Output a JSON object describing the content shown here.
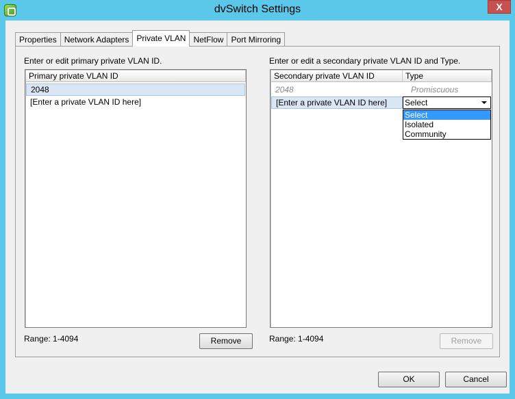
{
  "window": {
    "title": "dvSwitch Settings",
    "close_label": "X"
  },
  "tabs": [
    {
      "label": "Properties"
    },
    {
      "label": "Network Adapters"
    },
    {
      "label": "Private VLAN"
    },
    {
      "label": "NetFlow"
    },
    {
      "label": "Port Mirroring"
    }
  ],
  "primary": {
    "instruction": "Enter or edit primary private VLAN ID.",
    "column": "Primary private VLAN ID",
    "rows": [
      "2048",
      "[Enter a private VLAN ID here]"
    ],
    "range": "Range: 1-4094",
    "remove_label": "Remove"
  },
  "secondary": {
    "instruction": "Enter or edit a secondary private VLAN ID and Type.",
    "columns": [
      "Secondary private VLAN ID",
      "Type"
    ],
    "rows": [
      {
        "id": "2048",
        "type": "Promiscuous"
      },
      {
        "id": "[Enter a private VLAN ID here]",
        "type": "Select"
      }
    ],
    "type_options": [
      "Select",
      "Isolated",
      "Community"
    ],
    "range": "Range: 1-4094",
    "remove_label": "Remove"
  },
  "footer": {
    "ok_label": "OK",
    "cancel_label": "Cancel"
  }
}
